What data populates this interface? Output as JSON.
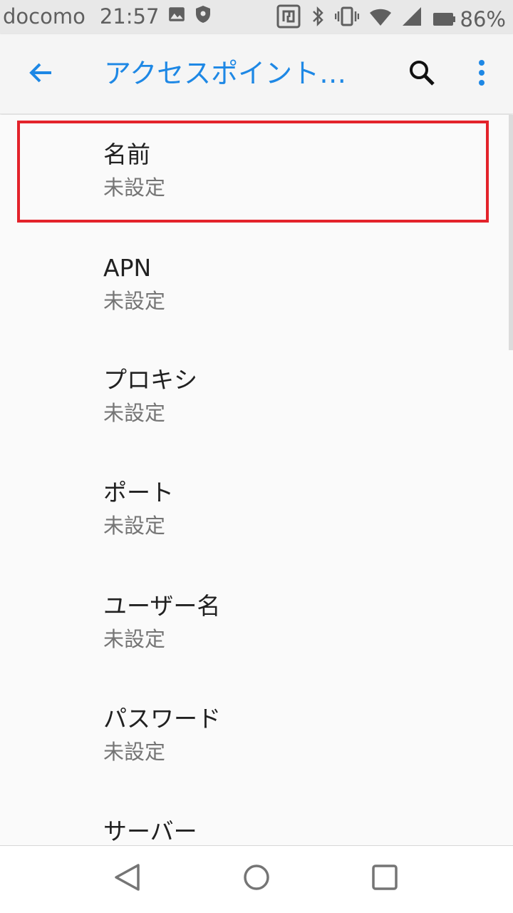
{
  "status_bar": {
    "carrier": "docomo",
    "time": "21:57",
    "battery_percent": "86%",
    "left_icons": [
      "image-icon",
      "shield-icon"
    ],
    "right_icons": [
      "nfc-icon",
      "bluetooth-icon",
      "vibrate-icon",
      "wifi-icon",
      "cell-signal-icon",
      "battery-icon"
    ]
  },
  "app_bar": {
    "title": "アクセスポイント…",
    "icons": [
      "back-arrow-icon",
      "search-icon",
      "more-vert-icon"
    ]
  },
  "colors": {
    "accent": "#1e88e5",
    "highlight": "#e3232b",
    "background": "#fafafa"
  },
  "settings": [
    {
      "title": "名前",
      "summary": "未設定"
    },
    {
      "title": "APN",
      "summary": "未設定"
    },
    {
      "title": "プロキシ",
      "summary": "未設定"
    },
    {
      "title": "ポート",
      "summary": "未設定"
    },
    {
      "title": "ユーザー名",
      "summary": "未設定"
    },
    {
      "title": "パスワード",
      "summary": "未設定"
    },
    {
      "title": "サーバー",
      "summary": ""
    }
  ],
  "nav_bar": {
    "icons": [
      "back-triangle-icon",
      "home-circle-icon",
      "recents-square-icon"
    ]
  }
}
